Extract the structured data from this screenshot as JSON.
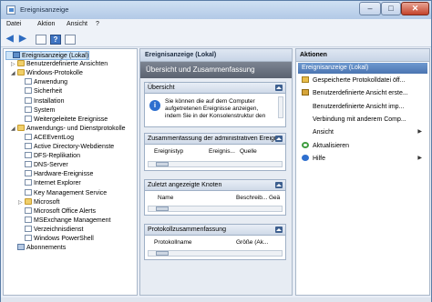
{
  "window": {
    "title": "Ereignisanzeige"
  },
  "menu": [
    "Datei",
    "Aktion",
    "Ansicht",
    "?"
  ],
  "toolbar": {
    "back_icon": "arrow-left",
    "forward_icon": "arrow-right",
    "help_symbol": "?"
  },
  "tree": {
    "items": [
      {
        "label": "Ereignisanzeige (Lokal)",
        "level": 0,
        "expand": "",
        "icon": "root",
        "selected": true
      },
      {
        "label": "Benutzerdefinierte Ansichten",
        "level": 1,
        "expand": "▷",
        "icon": "folder"
      },
      {
        "label": "Windows-Protokolle",
        "level": 1,
        "expand": "◢",
        "icon": "folder"
      },
      {
        "label": "Anwendung",
        "level": 2,
        "expand": "",
        "icon": "log"
      },
      {
        "label": "Sicherheit",
        "level": 2,
        "expand": "",
        "icon": "log"
      },
      {
        "label": "Installation",
        "level": 2,
        "expand": "",
        "icon": "log"
      },
      {
        "label": "System",
        "level": 2,
        "expand": "",
        "icon": "log"
      },
      {
        "label": "Weitergeleitete Ereignisse",
        "level": 2,
        "expand": "",
        "icon": "log"
      },
      {
        "label": "Anwendungs- und Dienstprotokolle",
        "level": 1,
        "expand": "◢",
        "icon": "folder"
      },
      {
        "label": "ACEEventLog",
        "level": 2,
        "expand": "",
        "icon": "log"
      },
      {
        "label": "Active Directory-Webdienste",
        "level": 2,
        "expand": "",
        "icon": "log"
      },
      {
        "label": "DFS-Replikation",
        "level": 2,
        "expand": "",
        "icon": "log"
      },
      {
        "label": "DNS-Server",
        "level": 2,
        "expand": "",
        "icon": "log"
      },
      {
        "label": "Hardware-Ereignisse",
        "level": 2,
        "expand": "",
        "icon": "log"
      },
      {
        "label": "Internet Explorer",
        "level": 2,
        "expand": "",
        "icon": "log"
      },
      {
        "label": "Key Management Service",
        "level": 2,
        "expand": "",
        "icon": "log"
      },
      {
        "label": "Microsoft",
        "level": 2,
        "expand": "▷",
        "icon": "folder"
      },
      {
        "label": "Microsoft Office Alerts",
        "level": 2,
        "expand": "",
        "icon": "log"
      },
      {
        "label": "MSExchange Management",
        "level": 2,
        "expand": "",
        "icon": "log"
      },
      {
        "label": "Verzeichnisdienst",
        "level": 2,
        "expand": "",
        "icon": "log"
      },
      {
        "label": "Windows PowerShell",
        "level": 2,
        "expand": "",
        "icon": "log"
      },
      {
        "label": "Abonnements",
        "level": 1,
        "expand": "",
        "icon": "sub"
      }
    ]
  },
  "center": {
    "header": "Ereignisanzeige (Lokal)",
    "banner": "Übersicht und Zusammenfassung",
    "overview": {
      "title": "Übersicht",
      "text": "Sie können die auf dem Computer aufgetretenen Ereignisse anzeigen, indem Sie in der Konsolenstruktur den Knoten für die Quelle, das"
    },
    "summary": {
      "title": "Zusammenfassung der administrativen Ereignisse",
      "columns": [
        "Ereignistyp",
        "Ereignis...",
        "Quelle"
      ]
    },
    "recent": {
      "title": "Zuletzt angezeigte Knoten",
      "columns": [
        "Name",
        "Beschreib...",
        "Geä"
      ]
    },
    "logsummary": {
      "title": "Protokollzusammenfassung",
      "columns": [
        "Protokollname",
        "Größe (Ak..."
      ]
    }
  },
  "actions": {
    "header": "Aktionen",
    "group": "Ereignisanzeige (Lokal)",
    "items": [
      {
        "label": "Gespeicherte Protokolldatei öff...",
        "icon": "open",
        "submenu": false
      },
      {
        "label": "Benutzerdefinierte Ansicht erste...",
        "icon": "filter",
        "submenu": false
      },
      {
        "label": "Benutzerdefinierte Ansicht imp...",
        "icon": "none",
        "submenu": false
      },
      {
        "label": "Verbindung mit anderem Comp...",
        "icon": "none",
        "submenu": false
      },
      {
        "label": "Ansicht",
        "icon": "none",
        "submenu": true
      },
      {
        "label": "Aktualisieren",
        "icon": "refresh",
        "submenu": false
      },
      {
        "label": "Hilfe",
        "icon": "help",
        "submenu": true
      }
    ]
  },
  "colors": {
    "accent": "#4a74b1",
    "banner": "#5a6270",
    "selection": "#cde4f8"
  }
}
